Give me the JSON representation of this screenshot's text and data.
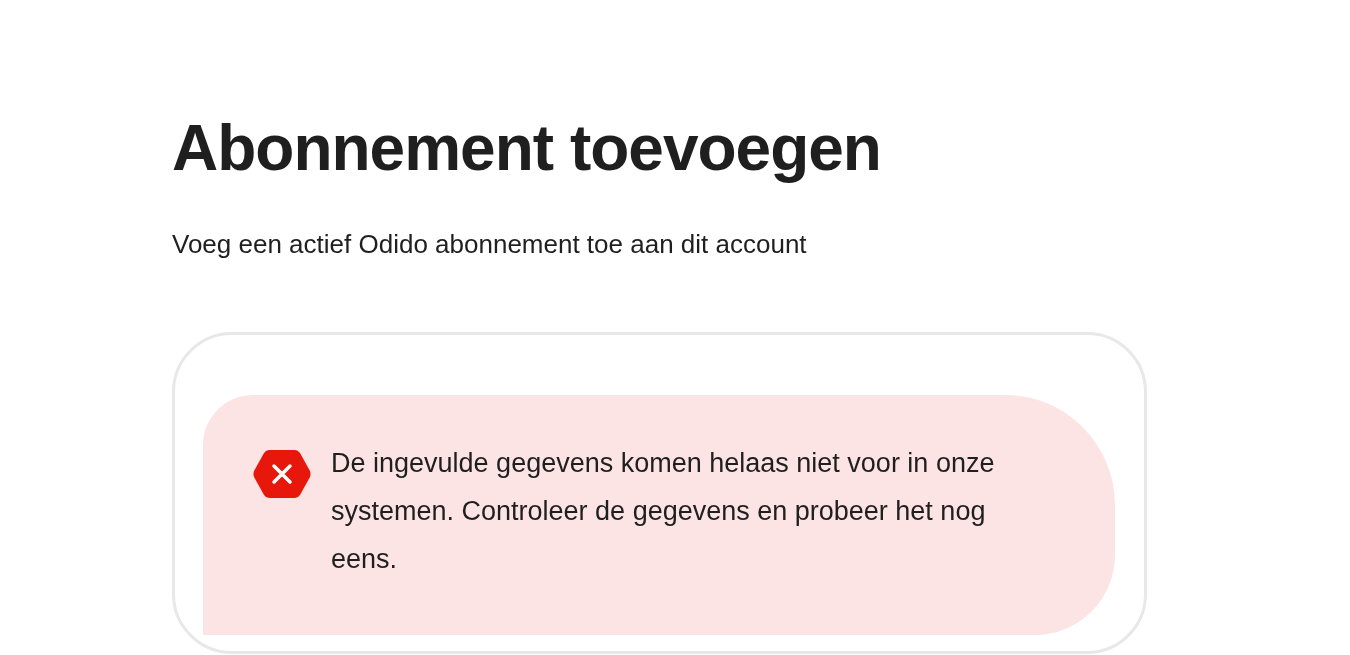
{
  "title": "Abonnement toevoegen",
  "subtitle": "Voeg een actief Odido abonnement toe aan dit account",
  "alert": {
    "kind": "error",
    "message": "De ingevulde gegevens komen helaas niet voor in onze systemen. Controleer de gegevens en probeer het nog eens."
  }
}
